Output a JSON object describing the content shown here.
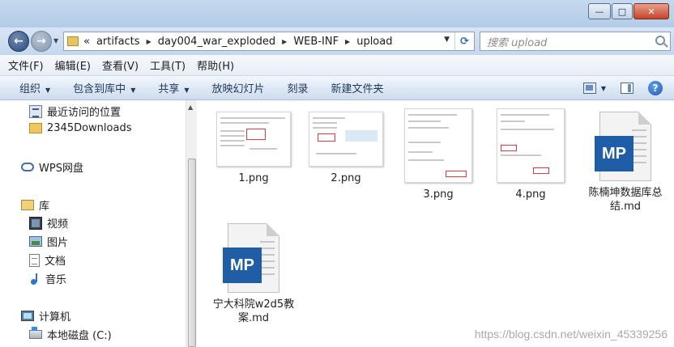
{
  "window": {
    "minimize_label": "—",
    "maximize_label": "□",
    "close_label": "✕"
  },
  "address": {
    "overflow": "«",
    "crumbs": [
      "artifacts",
      "day004_war_exploded",
      "WEB-INF",
      "upload"
    ],
    "refresh_label": "⟳"
  },
  "search": {
    "placeholder": "搜索 upload"
  },
  "menu": [
    "文件(F)",
    "编辑(E)",
    "查看(V)",
    "工具(T)",
    "帮助(H)"
  ],
  "commands": {
    "organize": "组织",
    "include_library": "包含到库中",
    "share": "共享",
    "slideshow": "放映幻灯片",
    "burn": "刻录",
    "new_folder": "新建文件夹",
    "help_label": "?"
  },
  "nav": {
    "recent": "最近访问的位置",
    "downloads": "2345Downloads",
    "wps": "WPS网盘",
    "library": "库",
    "video": "视频",
    "pictures": "图片",
    "documents": "文档",
    "music": "音乐",
    "computer": "计算机",
    "local_disk": "本地磁盘 (C:)"
  },
  "files": [
    {
      "name": "1.png",
      "type": "png"
    },
    {
      "name": "2.png",
      "type": "png"
    },
    {
      "name": "3.png",
      "type": "png"
    },
    {
      "name": "4.png",
      "type": "png"
    },
    {
      "name": "陈楠坤数据库总结.md",
      "type": "md",
      "badge": "MP"
    },
    {
      "name": "宁大科院w2d5教案.md",
      "type": "md",
      "badge": "MP"
    }
  ],
  "watermark": "https://blog.csdn.net/weixin_45339256",
  "colors": {
    "accent": "#1f5da6",
    "close": "#c6452b"
  }
}
